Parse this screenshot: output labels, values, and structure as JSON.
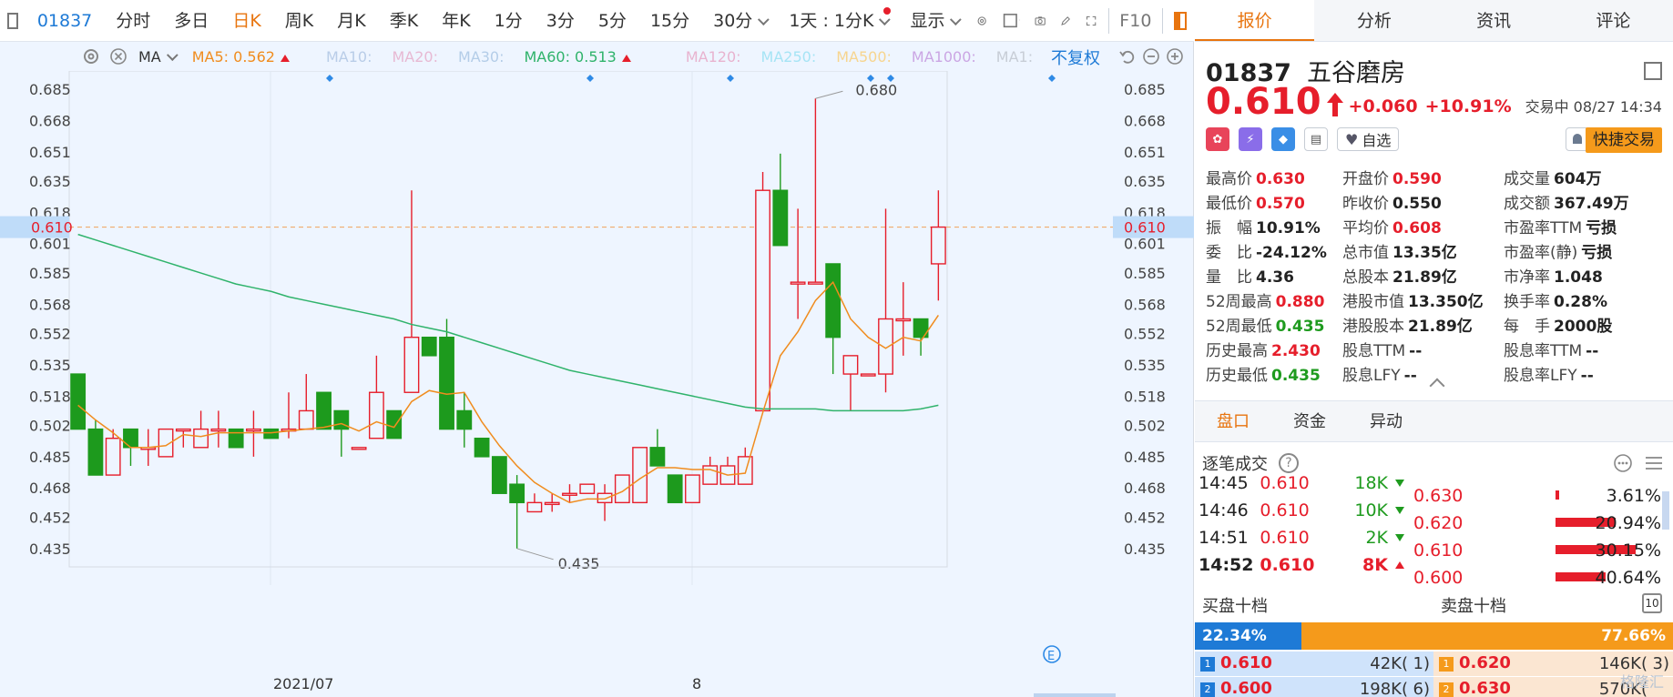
{
  "toolbar": {
    "code": "01837",
    "items": [
      "分时",
      "多日",
      "日K",
      "周K",
      "月K",
      "季K",
      "年K",
      "1分",
      "3分",
      "5分",
      "15分",
      "30分"
    ],
    "active": "日K",
    "period_select": "1天 : 1分K",
    "display": "显示",
    "f10": "F10"
  },
  "ma": {
    "label": "MA",
    "ma5": "MA5: 0.562",
    "ma10": "MA10:",
    "ma20": "MA20:",
    "ma30": "MA30:",
    "ma60": "MA60: 0.513",
    "ma120": "MA120:",
    "ma250": "MA250:",
    "ma500": "MA500:",
    "ma1000": "MA1000:",
    "ma1": "MA1:",
    "fuquan": "不复权",
    "colors": {
      "ma5": "#f08c1e",
      "ma10": "#d9e4f5",
      "ma20": "#f3d2e4",
      "ma30": "#cfe0f6",
      "ma60": "#2fb36b",
      "ma120": "#f4cfe3",
      "ma250": "#c8f0fa",
      "ma500": "#fde5b5",
      "ma1000": "#e2c6f2",
      "ma1": "#d6dbe3"
    }
  },
  "chart_data": {
    "type": "candlestick",
    "y_ticks": [
      "0.685",
      "0.668",
      "0.651",
      "0.635",
      "0.618",
      "0.601",
      "0.585",
      "0.568",
      "0.552",
      "0.535",
      "0.518",
      "0.502",
      "0.485",
      "0.468",
      "0.452",
      "0.435"
    ],
    "ylim": [
      0.425,
      0.695
    ],
    "x_labels": [
      "2021/07",
      "8"
    ],
    "current_price_label": "0.610",
    "annotations": {
      "high": "0.680",
      "low": "0.435"
    },
    "up_color": "#e61e2b",
    "down_color": "#1d9a1d",
    "candles": [
      {
        "o": 0.53,
        "h": 0.53,
        "l": 0.5,
        "c": 0.5
      },
      {
        "o": 0.5,
        "h": 0.505,
        "l": 0.475,
        "c": 0.475
      },
      {
        "o": 0.475,
        "h": 0.5,
        "l": 0.475,
        "c": 0.495
      },
      {
        "o": 0.5,
        "h": 0.5,
        "l": 0.48,
        "c": 0.49
      },
      {
        "o": 0.49,
        "h": 0.5,
        "l": 0.48,
        "c": 0.49
      },
      {
        "o": 0.485,
        "h": 0.5,
        "l": 0.485,
        "c": 0.5
      },
      {
        "o": 0.5,
        "h": 0.5,
        "l": 0.49,
        "c": 0.5
      },
      {
        "o": 0.49,
        "h": 0.51,
        "l": 0.49,
        "c": 0.5
      },
      {
        "o": 0.5,
        "h": 0.51,
        "l": 0.49,
        "c": 0.5
      },
      {
        "o": 0.5,
        "h": 0.5,
        "l": 0.49,
        "c": 0.49
      },
      {
        "o": 0.5,
        "h": 0.51,
        "l": 0.485,
        "c": 0.5
      },
      {
        "o": 0.5,
        "h": 0.5,
        "l": 0.495,
        "c": 0.495
      },
      {
        "o": 0.5,
        "h": 0.52,
        "l": 0.495,
        "c": 0.5
      },
      {
        "o": 0.5,
        "h": 0.53,
        "l": 0.5,
        "c": 0.51
      },
      {
        "o": 0.52,
        "h": 0.52,
        "l": 0.5,
        "c": 0.5
      },
      {
        "o": 0.51,
        "h": 0.51,
        "l": 0.485,
        "c": 0.5
      },
      {
        "o": 0.49,
        "h": 0.49,
        "l": 0.49,
        "c": 0.49
      },
      {
        "o": 0.495,
        "h": 0.54,
        "l": 0.495,
        "c": 0.52
      },
      {
        "o": 0.51,
        "h": 0.51,
        "l": 0.495,
        "c": 0.495
      },
      {
        "o": 0.52,
        "h": 0.63,
        "l": 0.52,
        "c": 0.55
      },
      {
        "o": 0.55,
        "h": 0.55,
        "l": 0.54,
        "c": 0.54
      },
      {
        "o": 0.55,
        "h": 0.56,
        "l": 0.5,
        "c": 0.5
      },
      {
        "o": 0.51,
        "h": 0.52,
        "l": 0.49,
        "c": 0.5
      },
      {
        "o": 0.495,
        "h": 0.495,
        "l": 0.485,
        "c": 0.485
      },
      {
        "o": 0.485,
        "h": 0.485,
        "l": 0.465,
        "c": 0.465
      },
      {
        "o": 0.47,
        "h": 0.475,
        "l": 0.435,
        "c": 0.46
      },
      {
        "o": 0.455,
        "h": 0.465,
        "l": 0.455,
        "c": 0.46
      },
      {
        "o": 0.46,
        "h": 0.465,
        "l": 0.455,
        "c": 0.46
      },
      {
        "o": 0.465,
        "h": 0.47,
        "l": 0.46,
        "c": 0.465
      },
      {
        "o": 0.465,
        "h": 0.47,
        "l": 0.465,
        "c": 0.47
      },
      {
        "o": 0.46,
        "h": 0.47,
        "l": 0.45,
        "c": 0.465
      },
      {
        "o": 0.46,
        "h": 0.475,
        "l": 0.46,
        "c": 0.475
      },
      {
        "o": 0.46,
        "h": 0.49,
        "l": 0.46,
        "c": 0.49
      },
      {
        "o": 0.49,
        "h": 0.5,
        "l": 0.48,
        "c": 0.48
      },
      {
        "o": 0.475,
        "h": 0.475,
        "l": 0.46,
        "c": 0.46
      },
      {
        "o": 0.46,
        "h": 0.475,
        "l": 0.46,
        "c": 0.475
      },
      {
        "o": 0.47,
        "h": 0.485,
        "l": 0.47,
        "c": 0.48
      },
      {
        "o": 0.47,
        "h": 0.485,
        "l": 0.47,
        "c": 0.48
      },
      {
        "o": 0.47,
        "h": 0.49,
        "l": 0.47,
        "c": 0.485
      },
      {
        "o": 0.51,
        "h": 0.64,
        "l": 0.51,
        "c": 0.63
      },
      {
        "o": 0.63,
        "h": 0.65,
        "l": 0.6,
        "c": 0.6
      },
      {
        "o": 0.58,
        "h": 0.62,
        "l": 0.56,
        "c": 0.58
      },
      {
        "o": 0.58,
        "h": 0.68,
        "l": 0.58,
        "c": 0.58
      },
      {
        "o": 0.59,
        "h": 0.59,
        "l": 0.53,
        "c": 0.55
      },
      {
        "o": 0.53,
        "h": 0.54,
        "l": 0.51,
        "c": 0.54
      },
      {
        "o": 0.53,
        "h": 0.53,
        "l": 0.53,
        "c": 0.53
      },
      {
        "o": 0.53,
        "h": 0.62,
        "l": 0.52,
        "c": 0.56
      },
      {
        "o": 0.56,
        "h": 0.58,
        "l": 0.54,
        "c": 0.56
      },
      {
        "o": 0.56,
        "h": 0.56,
        "l": 0.54,
        "c": 0.55
      },
      {
        "o": 0.59,
        "h": 0.63,
        "l": 0.57,
        "c": 0.61
      }
    ],
    "ma5": [
      0.513,
      0.505,
      0.498,
      0.49,
      0.49,
      0.491,
      0.497,
      0.496,
      0.498,
      0.498,
      0.498,
      0.498,
      0.499,
      0.5,
      0.501,
      0.503,
      0.499,
      0.504,
      0.501,
      0.515,
      0.521,
      0.519,
      0.52,
      0.504,
      0.491,
      0.48,
      0.471,
      0.465,
      0.46,
      0.462,
      0.462,
      0.466,
      0.473,
      0.479,
      0.479,
      0.478,
      0.478,
      0.475,
      0.476,
      0.509,
      0.54,
      0.553,
      0.57,
      0.58,
      0.56,
      0.55,
      0.544,
      0.55,
      0.548,
      0.562
    ],
    "ma60": [
      0.606,
      0.603,
      0.6,
      0.597,
      0.594,
      0.591,
      0.588,
      0.585,
      0.582,
      0.579,
      0.577,
      0.575,
      0.572,
      0.57,
      0.568,
      0.566,
      0.564,
      0.562,
      0.56,
      0.557,
      0.555,
      0.553,
      0.55,
      0.547,
      0.544,
      0.541,
      0.538,
      0.535,
      0.532,
      0.53,
      0.528,
      0.526,
      0.524,
      0.522,
      0.52,
      0.518,
      0.516,
      0.514,
      0.512,
      0.511,
      0.511,
      0.511,
      0.511,
      0.51,
      0.51,
      0.51,
      0.51,
      0.51,
      0.511,
      0.513
    ]
  },
  "tabs": [
    "报价",
    "分析",
    "资讯",
    "评论"
  ],
  "active_tab": "报价",
  "stock": {
    "code": "01837",
    "name": "五谷磨房",
    "price": "0.610",
    "change": "+0.060",
    "change_pct": "+10.91%",
    "status": "交易中 08/27 14:34",
    "watch": "自选",
    "quick_trade": "快捷交易"
  },
  "stats": [
    [
      {
        "k": "最高价",
        "v": "0.630",
        "c": "red"
      },
      {
        "k": "开盘价",
        "v": "0.590",
        "c": "red"
      },
      {
        "k": "成交量",
        "v": "604万",
        "c": "blk"
      }
    ],
    [
      {
        "k": "最低价",
        "v": "0.570",
        "c": "red"
      },
      {
        "k": "昨收价",
        "v": "0.550",
        "c": "blk"
      },
      {
        "k": "成交额",
        "v": "367.49万",
        "c": "blk"
      }
    ],
    [
      {
        "k": "振　幅",
        "v": "10.91%",
        "c": "blk"
      },
      {
        "k": "平均价",
        "v": "0.608",
        "c": "red"
      },
      {
        "k": "市盈率TTM",
        "v": "亏损",
        "c": "blk"
      }
    ],
    [
      {
        "k": "委　比",
        "v": "-24.12%",
        "c": "blk"
      },
      {
        "k": "总市值",
        "v": "13.35亿",
        "c": "blk"
      },
      {
        "k": "市盈率(静)",
        "v": "亏损",
        "c": "blk"
      }
    ],
    [
      {
        "k": "量　比",
        "v": "4.36",
        "c": "blk"
      },
      {
        "k": "总股本",
        "v": "21.89亿",
        "c": "blk"
      },
      {
        "k": "市净率",
        "v": "1.048",
        "c": "blk"
      }
    ],
    [
      {
        "k": "52周最高",
        "v": "0.880",
        "c": "red"
      },
      {
        "k": "港股市值",
        "v": "13.350亿",
        "c": "blk"
      },
      {
        "k": "换手率",
        "v": "0.28%",
        "c": "blk"
      }
    ],
    [
      {
        "k": "52周最低",
        "v": "0.435",
        "c": "grn"
      },
      {
        "k": "港股股本",
        "v": "21.89亿",
        "c": "blk"
      },
      {
        "k": "每　手",
        "v": "2000股",
        "c": "blk"
      }
    ],
    [
      {
        "k": "历史最高",
        "v": "2.430",
        "c": "red"
      },
      {
        "k": "股息TTM",
        "v": "--",
        "c": "blk"
      },
      {
        "k": "股息率TTM",
        "v": "--",
        "c": "blk"
      }
    ],
    [
      {
        "k": "历史最低",
        "v": "0.435",
        "c": "grn"
      },
      {
        "k": "股息LFY",
        "v": "--",
        "c": "blk"
      },
      {
        "k": "股息率LFY",
        "v": "--",
        "c": "blk"
      }
    ]
  ],
  "panel_tabs": [
    "盘口",
    "资金",
    "异动"
  ],
  "ticks_title": "逐笔成交",
  "ticks": [
    {
      "t": "14:45",
      "p": "0.610",
      "v": "18K",
      "d": "dn"
    },
    {
      "t": "14:46",
      "p": "0.610",
      "v": "10K",
      "d": "dn"
    },
    {
      "t": "14:51",
      "p": "0.610",
      "v": "2K",
      "d": "dn"
    },
    {
      "t": "14:52",
      "p": "0.610",
      "v": "8K",
      "d": "up"
    }
  ],
  "price_dist": [
    {
      "p": "0.630",
      "pct": "3.61%",
      "frac": 0.04
    },
    {
      "p": "0.620",
      "pct": "20.94%",
      "frac": 0.6
    },
    {
      "p": "0.610",
      "pct": "30.15%",
      "frac": 0.8
    },
    {
      "p": "0.600",
      "pct": "40.64%",
      "frac": 0.5
    }
  ],
  "orderbook": {
    "buy_title": "买盘十档",
    "sell_title": "卖盘十档",
    "buy_pct": "22.34%",
    "sell_pct": "77.66%",
    "buy_frac": 0.2234,
    "ten": "10",
    "rows": [
      {
        "bl": "1",
        "bp": "0.610",
        "bv": "42K(",
        "bn": "1)",
        "al": "1",
        "ap": "0.620",
        "av": "146K(",
        "an": "3)"
      },
      {
        "bl": "2",
        "bp": "0.600",
        "bv": "198K(",
        "bn": "6)",
        "al": "2",
        "ap": "0.630",
        "av": "570K(",
        "an": ""
      }
    ]
  },
  "watermark": "格隆汇"
}
